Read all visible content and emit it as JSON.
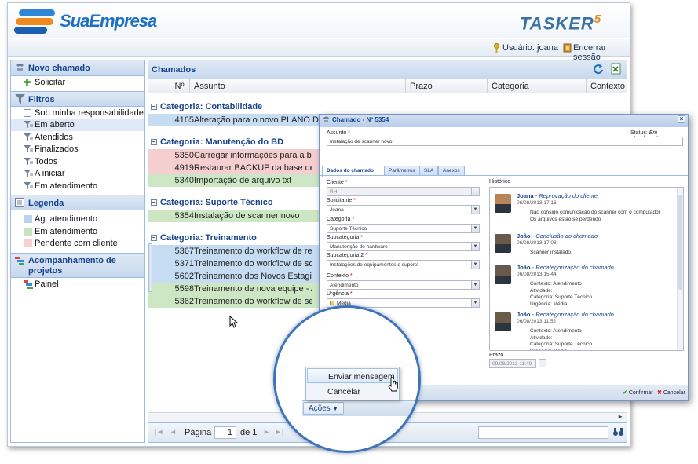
{
  "brand": {
    "name": "SuaEmpresa",
    "product": "TASKER",
    "version": "5"
  },
  "userbar": {
    "user": "Usuário: joana",
    "logout": "Encerrar sessão"
  },
  "left": {
    "new_ticket": {
      "title": "Novo chamado",
      "items": [
        "Solicitar"
      ]
    },
    "filters": {
      "title": "Filtros",
      "items": [
        "Sob minha responsabilidade",
        "Em aberto",
        "Atendidos",
        "Finalizados",
        "Todos",
        "A iniciar",
        "Em atendimento"
      ]
    },
    "legend": {
      "title": "Legenda",
      "items": [
        {
          "label": "Ag. atendimento",
          "color": "#b9d3ee"
        },
        {
          "label": "Em atendimento",
          "color": "#c8e3bf"
        },
        {
          "label": "Pendente com cliente",
          "color": "#f6d1d1"
        }
      ]
    },
    "projects": {
      "title": "Acompanhamento de projetos",
      "items": [
        "Painel"
      ]
    }
  },
  "grid": {
    "title": "Chamados",
    "columns": [
      "Nº",
      "Assunto",
      "Prazo",
      "Categoria",
      "Contexto"
    ],
    "groups": [
      {
        "label": "Categoria: Contabilidade",
        "rows": [
          {
            "id": "4165",
            "subject": "Alteração para o novo PLANO DE CONT",
            "status": "blue"
          }
        ]
      },
      {
        "label": "Categoria: Manutenção do BD",
        "rows": [
          {
            "id": "5350",
            "subject": "Carregar informações para a base de d",
            "status": "red"
          },
          {
            "id": "4919",
            "subject": "Restaurar BACKUP da base de dados c",
            "status": "red"
          },
          {
            "id": "5340",
            "subject": "Importação de arquivo txt",
            "status": "green"
          }
        ]
      },
      {
        "label": "Categoria: Suporte Técnico",
        "rows": [
          {
            "id": "5354",
            "subject": "Instalação de scanner novo",
            "status": "green"
          }
        ]
      },
      {
        "label": "Categoria: Treinamento",
        "rows": [
          {
            "id": "5367",
            "subject": "Treinamento do workflow de reembolso",
            "status": "blue"
          },
          {
            "id": "5371",
            "subject": "Treinamento do workflow de solicitação",
            "status": "blue"
          },
          {
            "id": "5602",
            "subject": "Treinamento dos Novos Estagiários",
            "status": "blue"
          },
          {
            "id": "5598",
            "subject": "Treinamento de nova equipe - Atendim",
            "status": "green"
          },
          {
            "id": "5362",
            "subject": "Treinamento do workflow de service des",
            "status": "green"
          }
        ]
      }
    ],
    "pager": {
      "page_label": "Página",
      "page": "1",
      "of": "de 1"
    }
  },
  "dialog": {
    "title": "Chamado - Nº 5354",
    "subject_label": "Assunto",
    "subject": "Instalação de scanner novo",
    "status_label": "Status:",
    "status": "Em atendimento",
    "tabs": [
      "Dados do chamado",
      "Parâmetros",
      "SLA",
      "Anexos"
    ],
    "fields": [
      {
        "label": "Cliente",
        "value": "RH",
        "req": true
      },
      {
        "label": "Solicitante",
        "value": "Joana",
        "req": true
      },
      {
        "label": "Categoria",
        "value": "Suporte Técnico",
        "req": true
      },
      {
        "label": "Subcategoria",
        "value": "Manutenção de hardware",
        "req": true
      },
      {
        "label": "Subcategoria 2",
        "value": "Instalações de equipamentos e suporte",
        "req": true
      },
      {
        "label": "Contexto",
        "value": "Atendimento",
        "req": true
      },
      {
        "label": "Urgência",
        "value": "Média",
        "req": true
      }
    ],
    "history_label": "Histórico",
    "history": [
      {
        "name": "Joana",
        "action": "Reprovação do cliente",
        "date": "06/08/2013 17:16",
        "lines": [
          "Não consigo comunicação do scanner com o computador",
          "Os arquivos estão se perdendo"
        ]
      },
      {
        "name": "João",
        "action": "Conclusão do chamado",
        "date": "06/08/2013 17:08",
        "lines": [
          "Scanner instalado."
        ]
      },
      {
        "name": "João",
        "action": "Recategorização do chamado",
        "date": "06/08/2013 15:44",
        "lines": [
          "Contexto: Atendimento",
          "Atividade:",
          "Categoria: Suporte Técnico",
          "Urgência: Média"
        ]
      },
      {
        "name": "João",
        "action": "Recategorização do chamado",
        "date": "06/08/2013 11:52",
        "lines": [
          "Contexto: Atendimento",
          "Atividade:",
          "Categoria: Suporte Técnico",
          "Urgência: Média"
        ]
      }
    ],
    "deadline_label": "Prazo",
    "deadline": "09/08/2013 11:49",
    "confirm": "Confirmar",
    "cancel": "Cancelar"
  },
  "actions": {
    "button": "Ações",
    "menu": [
      "Enviar mensagem",
      "Cancelar"
    ]
  },
  "colors": {
    "blue": "#c6dcf2",
    "green": "#cde6c4",
    "red": "#f5cfcf",
    "header": "#15428b"
  }
}
